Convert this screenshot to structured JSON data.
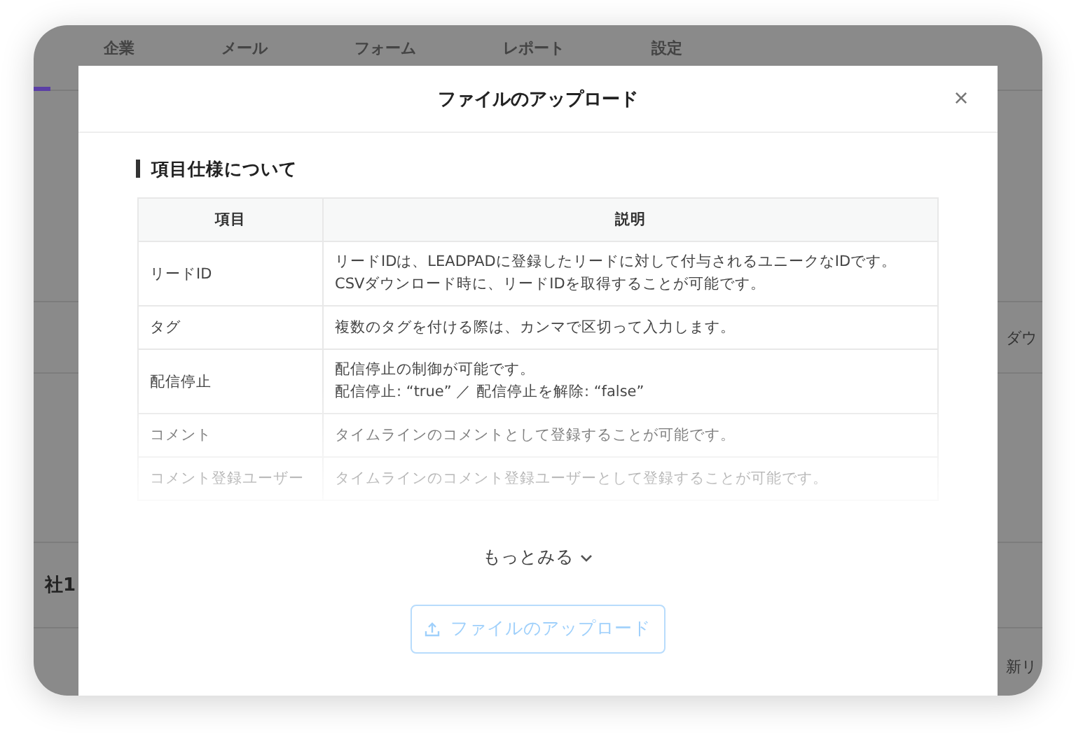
{
  "background_app": {
    "nav_tabs": [
      {
        "label": "企業",
        "selected": false
      },
      {
        "label": "メール",
        "selected": false
      },
      {
        "label": "フォーム",
        "selected": false
      },
      {
        "label": "レポート",
        "selected": false
      },
      {
        "label": "設定",
        "selected": false
      }
    ],
    "left_text": "社1",
    "right_button": "ダウ",
    "right_text": "新リ"
  },
  "modal": {
    "title": "ファイルのアップロード",
    "close": "×",
    "section_title": "項目仕様について",
    "table": {
      "columns": [
        "項目",
        "説明"
      ],
      "collapsed": true,
      "rows": [
        {
          "item": "リードID",
          "description": [
            "リードIDは、LEADPADに登録したリードに対して付与されるユニークなIDです。",
            "CSVダウンロード時に、リードIDを取得することが可能です。"
          ]
        },
        {
          "item": "タグ",
          "description": [
            "複数のタグを付ける際は、カンマで区切って入力します。"
          ]
        },
        {
          "item": "配信停止",
          "description": [
            "配信停止の制御が可能です。",
            "配信停止: “true” ／ 配信停止を解除: “false”"
          ]
        },
        {
          "item": "コメント",
          "description": [
            "タイムラインのコメントとして登録することが可能です。"
          ]
        },
        {
          "item": "コメント登録ユーザー",
          "description": [
            "タイムラインのコメント登録ユーザーとして登録することが可能です。"
          ]
        }
      ]
    },
    "show_more": "もっとみる",
    "upload_button": {
      "label": "ファイルのアップロード",
      "disabled": true
    }
  }
}
